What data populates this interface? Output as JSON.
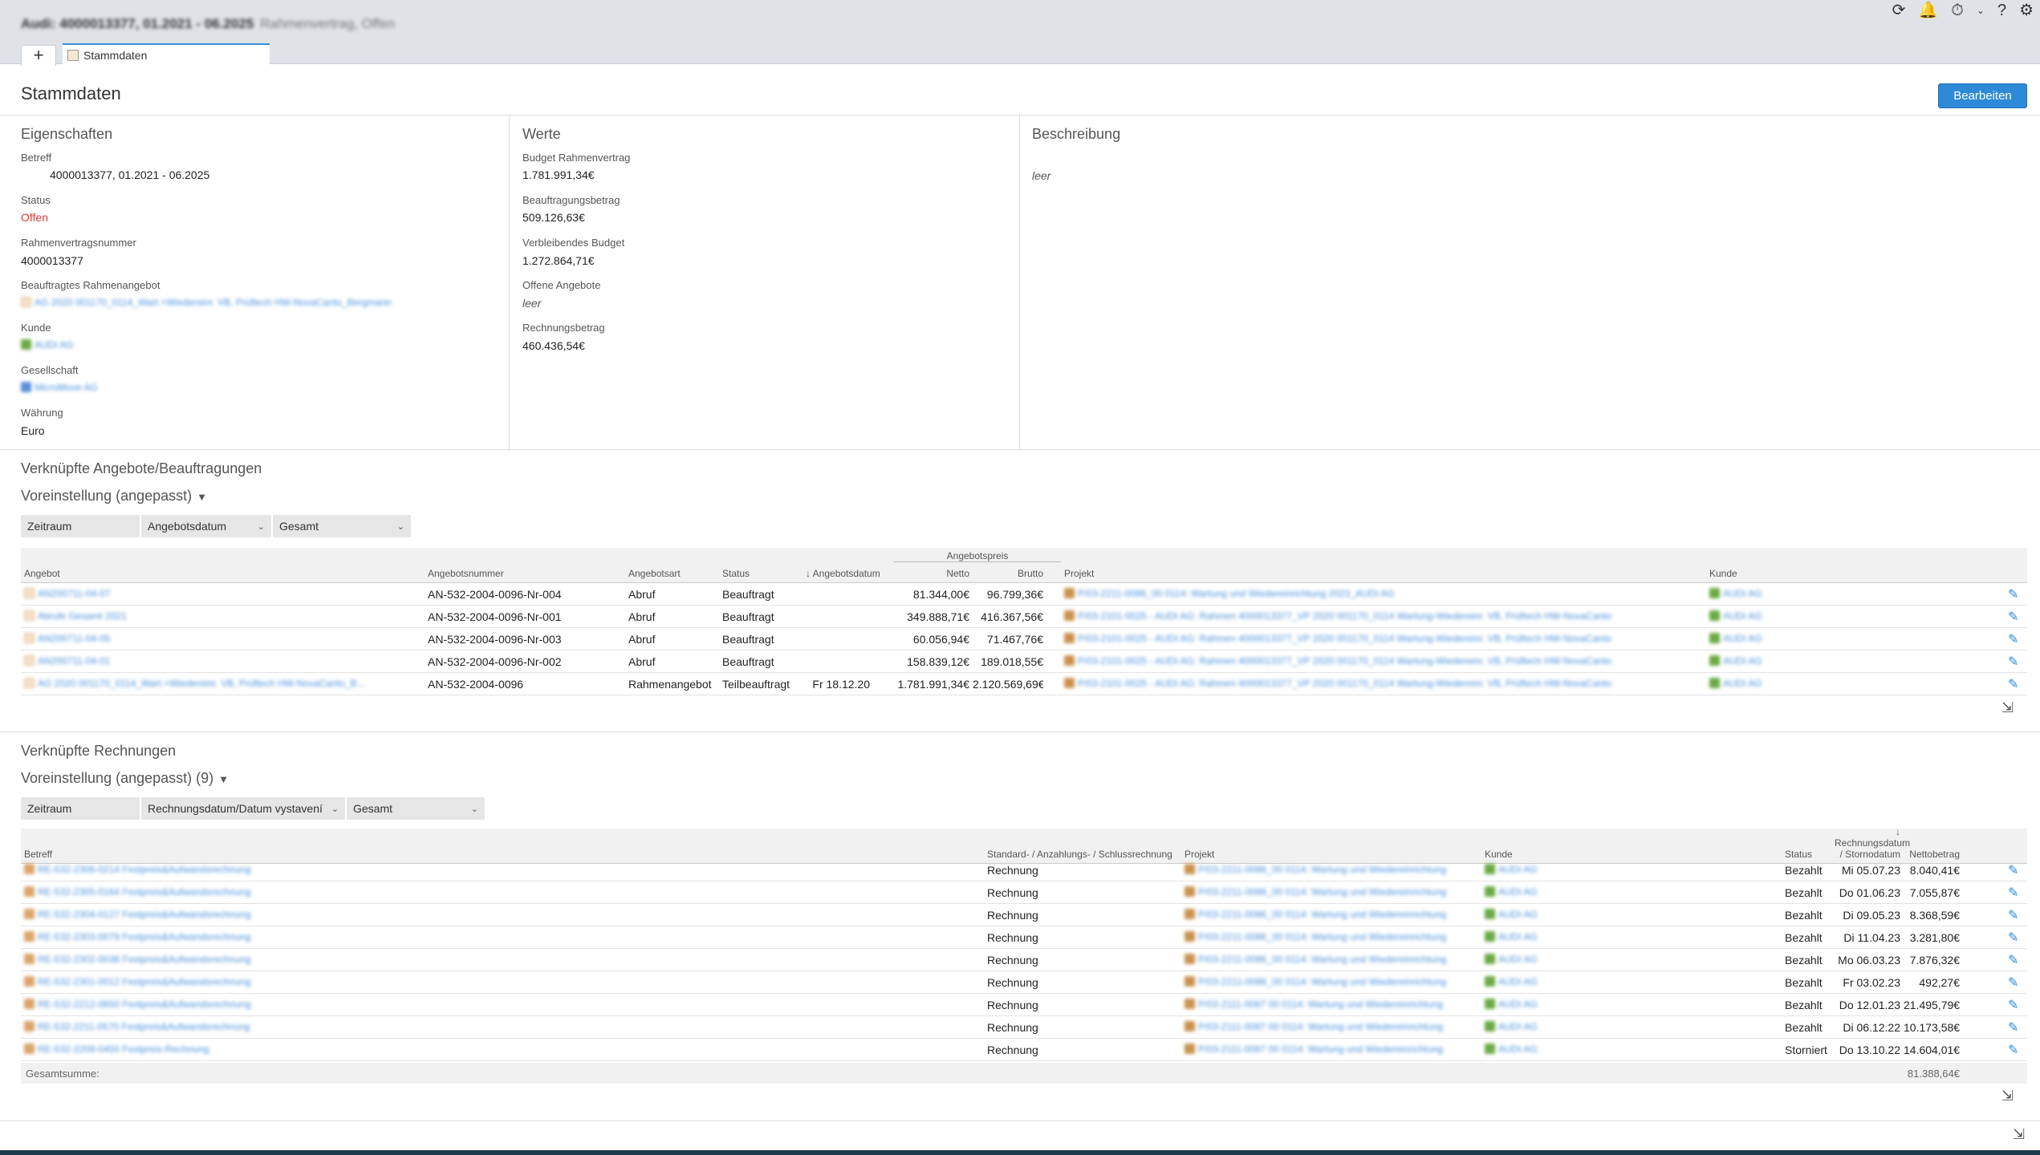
{
  "header": {
    "doc_title": "Audi: 4000013377, 01.2021 - 06.2025",
    "doc_subtitle": "Rahmenvertrag, Offen",
    "tab_add": "+",
    "tab_label": "Stammdaten"
  },
  "page": {
    "title": "Stammdaten",
    "edit_button": "Bearbeiten"
  },
  "eigenschaften": {
    "heading": "Eigenschaften",
    "betreff_label": "Betreff",
    "betreff_value": "4000013377, 01.2021 - 06.2025",
    "status_label": "Status",
    "status_value": "Offen",
    "rvnr_label": "Rahmenvertragsnummer",
    "rvnr_value": "4000013377",
    "angebot_label": "Beauftragtes Rahmenangebot",
    "angebot_value": "AG 2020 001170_0114_Wart.+Wiedereinr. VB, Prüftech HW-NovaCanto_Bergmann",
    "kunde_label": "Kunde",
    "kunde_value": "AUDI AG",
    "gesellschaft_label": "Gesellschaft",
    "gesellschaft_value": "MicroMove AG",
    "waehrung_label": "Währung",
    "waehrung_value": "Euro"
  },
  "werte": {
    "heading": "Werte",
    "budget_label": "Budget Rahmenvertrag",
    "budget_value": "1.781.991,34€",
    "beauftragung_label": "Beauftragungsbetrag",
    "beauftragung_value": "509.126,63€",
    "verbleibend_label": "Verbleibendes Budget",
    "verbleibend_value": "1.272.864,71€",
    "offene_label": "Offene Angebote",
    "offene_value": "leer",
    "rechnung_label": "Rechnungsbetrag",
    "rechnung_value": "460.436,54€"
  },
  "beschreibung": {
    "heading": "Beschreibung",
    "value": "leer"
  },
  "angebote": {
    "heading": "Verknüpfte Angebote/Beauftragungen",
    "preset": "Voreinstellung (angepasst)",
    "filter": [
      "Zeitraum",
      "Angebotsdatum",
      "Gesamt"
    ],
    "group_header": "Angebotspreis",
    "columns": {
      "angebot": "Angebot",
      "nummer": "Angebotsnummer",
      "art": "Angebotsart",
      "status": "Status",
      "datum": "↓ Angebotsdatum",
      "netto": "Netto",
      "brutto": "Brutto",
      "projekt": "Projekt",
      "kunde": "Kunde"
    },
    "rows": [
      {
        "angebot": "AN200711-04-07",
        "nummer": "AN-532-2004-0096-Nr-004",
        "art": "Abruf",
        "status": "Beauftragt",
        "datum": "",
        "netto": "81.344,00€",
        "brutto": "96.799,36€",
        "projekt": "P/03-2211-0086_00 0114: Wartung und Wiedereinrichtung 2023_AUDI AG",
        "kunde": "AUDI AG"
      },
      {
        "angebot": "Abrufe Gesamt 2021",
        "nummer": "AN-532-2004-0096-Nr-001",
        "art": "Abruf",
        "status": "Beauftragt",
        "datum": "",
        "netto": "349.888,71€",
        "brutto": "416.367,56€",
        "projekt": "P/03-2101-0025 - AUDI AG: Rahmen 4000013377_VP 2020 001170_0114 Wartung-Wiedereinr. VB, Prüftech HW-NovaCanto",
        "kunde": "AUDI AG"
      },
      {
        "angebot": "AN200711-04-05",
        "nummer": "AN-532-2004-0096-Nr-003",
        "art": "Abruf",
        "status": "Beauftragt",
        "datum": "",
        "netto": "60.056,94€",
        "brutto": "71.467,76€",
        "projekt": "P/03-2101-0025 - AUDI AG: Rahmen 4000013377_VP 2020 001170_0114 Wartung-Wiedereinr. VB, Prüftech HW-NovaCanto",
        "kunde": "AUDI AG"
      },
      {
        "angebot": "AN200711-04-01",
        "nummer": "AN-532-2004-0096-Nr-002",
        "art": "Abruf",
        "status": "Beauftragt",
        "datum": "",
        "netto": "158.839,12€",
        "brutto": "189.018,55€",
        "projekt": "P/03-2101-0025 - AUDI AG: Rahmen 4000013377_VP 2020 001170_0114 Wartung-Wiedereinr. VB, Prüftech HW-NovaCanto",
        "kunde": "AUDI AG"
      },
      {
        "angebot": "AG 2020 001170_0114_Wart.+Wiedereinr. VB, Prüftech HW-NovaCanto_B...",
        "nummer": "AN-532-2004-0096",
        "art": "Rahmenangebot",
        "status": "Teilbeauftragt",
        "datum": "Fr 18.12.20",
        "netto": "1.781.991,34€",
        "brutto": "2.120.569,69€",
        "projekt": "P/03-2101-0025 - AUDI AG: Rahmen 4000013377_VP 2020 001170_0114 Wartung-Wiedereinr. VB, Prüftech HW-NovaCanto",
        "kunde": "AUDI AG"
      }
    ]
  },
  "rechnungen": {
    "heading": "Verknüpfte Rechnungen",
    "preset": "Voreinstellung (angepasst) (9)",
    "filter": [
      "Zeitraum",
      "Rechnungsdatum/Datum vystavení",
      "Gesamt"
    ],
    "columns": {
      "betreff": "Betreff",
      "typ": "Standard- / Anzahlungs- / Schlussrechnung",
      "projekt": "Projekt",
      "kunde": "Kunde",
      "status": "Status",
      "datum_1": "↓ Rechnungsdatum",
      "datum_2": "/ Stornodatum",
      "netto": "Nettobetrag"
    },
    "rows": [
      {
        "betreff": "RE-532-2306-0214 Festpreis&Aufwandsrechnung",
        "typ": "Rechnung",
        "projekt": "P/03-2211-0086_00 0114: Wartung und Wiedereinrichtung",
        "kunde": "AUDI AG",
        "status": "Bezahlt",
        "datum": "Mi 05.07.23",
        "netto": "8.040,41€"
      },
      {
        "betreff": "RE-532-2305-0164 Festpreis&Aufwandsrechnung",
        "typ": "Rechnung",
        "projekt": "P/03-2211-0086_00 0114: Wartung und Wiedereinrichtung",
        "kunde": "AUDI AG",
        "status": "Bezahlt",
        "datum": "Do 01.06.23",
        "netto": "7.055,87€"
      },
      {
        "betreff": "RE-532-2304-0127 Festpreis&Aufwandsrechnung",
        "typ": "Rechnung",
        "projekt": "P/03-2211-0086_00 0114: Wartung und Wiedereinrichtung",
        "kunde": "AUDI AG",
        "status": "Bezahlt",
        "datum": "Di 09.05.23",
        "netto": "8.368,59€"
      },
      {
        "betreff": "RE-532-2303-0079 Festpreis&Aufwandsrechnung",
        "typ": "Rechnung",
        "projekt": "P/03-2211-0086_00 0114: Wartung und Wiedereinrichtung",
        "kunde": "AUDI AG",
        "status": "Bezahlt",
        "datum": "Di 11.04.23",
        "netto": "3.281,80€"
      },
      {
        "betreff": "RE-532-2302-0038 Festpreis&Aufwandsrechnung",
        "typ": "Rechnung",
        "projekt": "P/03-2211-0086_00 0114: Wartung und Wiedereinrichtung",
        "kunde": "AUDI AG",
        "status": "Bezahlt",
        "datum": "Mo 06.03.23",
        "netto": "7.876,32€"
      },
      {
        "betreff": "RE-532-2301-0012 Festpreis&Aufwandsrechnung",
        "typ": "Rechnung",
        "projekt": "P/03-2211-0086_00 0114: Wartung und Wiedereinrichtung",
        "kunde": "AUDI AG",
        "status": "Bezahlt",
        "datum": "Fr 03.02.23",
        "netto": "492,27€"
      },
      {
        "betreff": "RE-532-2212-0650 Festpreis&Aufwandsrechnung",
        "typ": "Rechnung",
        "projekt": "P/03-2111-0087 00 0114: Wartung und Wiedereinrichtung",
        "kunde": "AUDI AG",
        "status": "Bezahlt",
        "datum": "Do 12.01.23",
        "netto": "21.495,79€"
      },
      {
        "betreff": "RE-532-2211-0570 Festpreis&Aufwandsrechnung",
        "typ": "Rechnung",
        "projekt": "P/03-2111-0087 00 0114: Wartung und Wiedereinrichtung",
        "kunde": "AUDI AG",
        "status": "Bezahlt",
        "datum": "Di 06.12.22",
        "netto": "10.173,58€"
      },
      {
        "betreff": "RE-532-2209-0450 Festpreis-Rechnung",
        "typ": "Rechnung",
        "projekt": "P/03-2111-0087 00 0114: Wartung und Wiedereinrichtung",
        "kunde": "AUDI AG",
        "status": "Storniert",
        "datum": "Do 13.10.22",
        "netto": "14.604,01€"
      }
    ],
    "sum_label": "Gesamtsumme:",
    "sum_value": "81.388,64€"
  },
  "icons": {
    "refresh": "refresh-icon",
    "bell": "bell-icon",
    "stopwatch": "stopwatch-icon",
    "help": "help-icon",
    "settings": "gear-icon",
    "edit": "edit-icon",
    "export": "export-icon"
  },
  "colors": {
    "accent": "#2d8ad8",
    "status_open": "#e53935",
    "link": "#4a8fd8"
  }
}
